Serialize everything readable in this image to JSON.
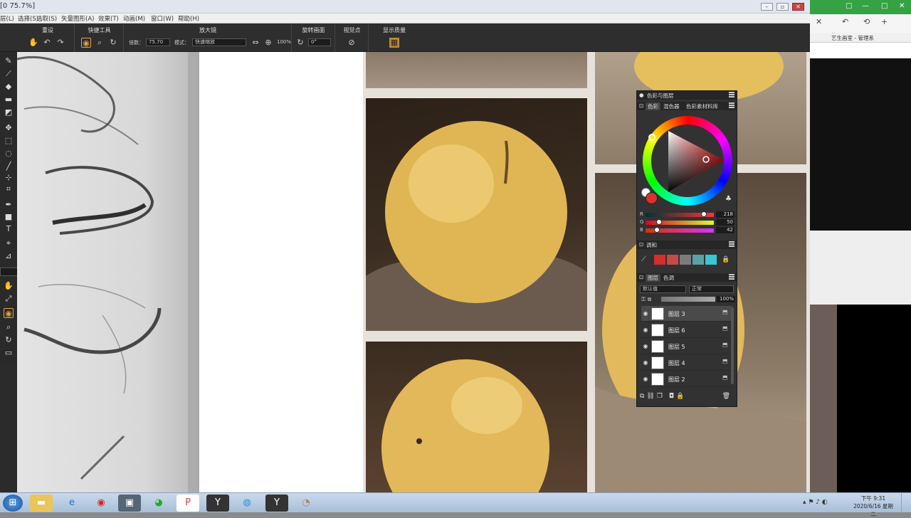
{
  "window": {
    "title": "[0 75.7%]"
  },
  "menu": [
    "层(L)",
    "选择(S)",
    "选取(S)",
    "矢量图形(A)",
    "效果(T)",
    "动画(M)",
    "窗口(W)",
    "帮助(H)"
  ],
  "toolbar": {
    "groups": [
      {
        "label": "重设"
      },
      {
        "label": "快捷工具"
      },
      {
        "label": "放大镜"
      },
      {
        "label": "旋转画面"
      },
      {
        "label": "视觉点"
      },
      {
        "label": "显示质量"
      }
    ],
    "zoom_label": "倍数：",
    "zoom_value": "75.70",
    "mode_label": "模式：",
    "mode_value": "快速缩放",
    "zoom_percent": "100%",
    "rotate_value": "0°"
  },
  "browser": {
    "bookmark": "艺生画室 - 管理系",
    "icon_glyphs": [
      "□",
      "—",
      "✕",
      "↶",
      "⟲",
      "+"
    ]
  },
  "colors": {
    "accent": "#e8a33c",
    "current": "#da322a"
  },
  "panel": {
    "title": "色彩与图层",
    "color_tabs": [
      "色彩",
      "混色器",
      "色彩素材料库"
    ],
    "rgb": [
      {
        "ch": "R",
        "value": "218",
        "frac": 0.855
      },
      {
        "ch": "G",
        "value": "50",
        "frac": 0.196
      },
      {
        "ch": "B",
        "value": "42",
        "frac": 0.165
      }
    ],
    "swatch_title": "调和",
    "swatches": [
      "#d42e2b",
      "#c84a48",
      "#7c7c7c",
      "#5aa1a8",
      "#3ac6d4"
    ],
    "layer_tabs": [
      "图层",
      "色调"
    ],
    "blend_value": "默认值",
    "mode_value": "正常",
    "opacity": "100%",
    "layers": [
      {
        "name": "图层 3"
      },
      {
        "name": "图层 6"
      },
      {
        "name": "图层 5"
      },
      {
        "name": "图层 4"
      },
      {
        "name": "图层 2"
      }
    ]
  },
  "taskbar": {
    "time": "下午 9:31",
    "date": "2020/6/16 星期二",
    "apps": [
      "files",
      "ie",
      "netease",
      "photo",
      "wechat",
      "ppt",
      "studio",
      "qq",
      "studio2",
      "dog"
    ]
  }
}
